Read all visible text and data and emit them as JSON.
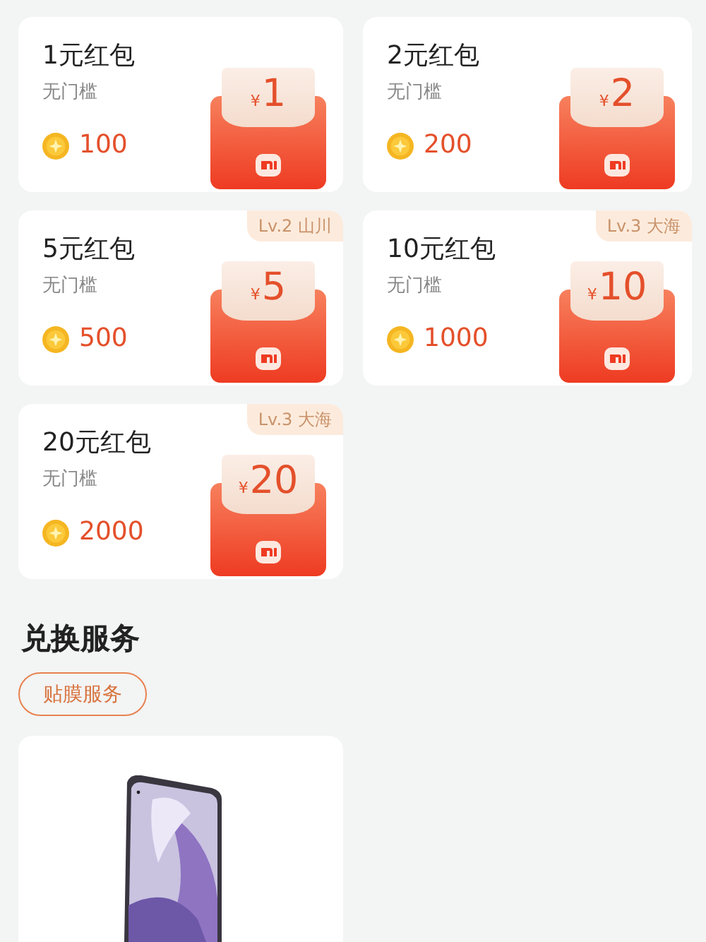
{
  "coupons": [
    {
      "title": "1元红包",
      "condition": "无门槛",
      "cost": "100",
      "currency": "¥",
      "amount": "1"
    },
    {
      "title": "2元红包",
      "condition": "无门槛",
      "cost": "200",
      "currency": "¥",
      "amount": "2"
    },
    {
      "title": "5元红包",
      "condition": "无门槛",
      "cost": "500",
      "currency": "¥",
      "amount": "5",
      "level_badge": "Lv.2 山川"
    },
    {
      "title": "10元红包",
      "condition": "无门槛",
      "cost": "1000",
      "currency": "¥",
      "amount": "10",
      "level_badge": "Lv.3 大海"
    },
    {
      "title": "20元红包",
      "condition": "无门槛",
      "cost": "2000",
      "currency": "¥",
      "amount": "20",
      "level_badge": "Lv.3 大海"
    }
  ],
  "services": {
    "heading": "兑换服务",
    "tabs": [
      {
        "label": "贴膜服务",
        "selected": true
      }
    ]
  }
}
